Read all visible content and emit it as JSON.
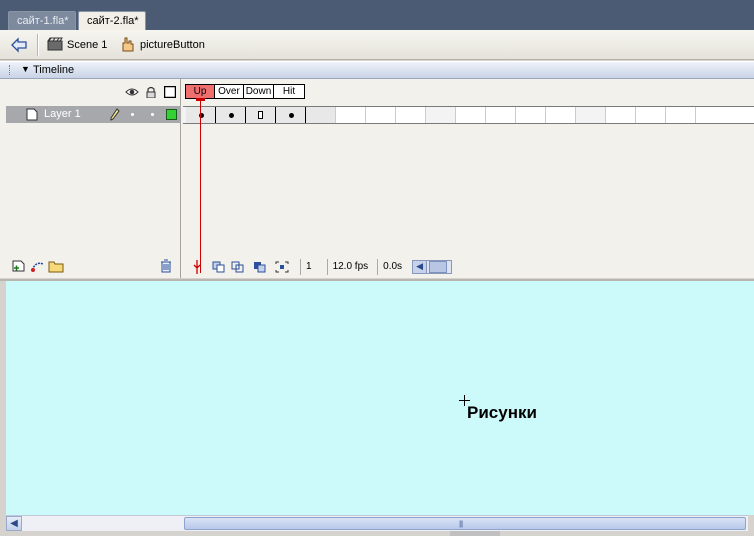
{
  "document_tabs": [
    {
      "label": "сайт-1.fla*",
      "active": false
    },
    {
      "label": "сайт-2.fla*",
      "active": true
    }
  ],
  "edit_bar": {
    "back_icon": "back-arrow-icon",
    "scene_label": "Scene 1",
    "symbol_label": "pictureButton"
  },
  "timeline": {
    "title": "Timeline",
    "header_icons": [
      "eye-icon",
      "lock-icon",
      "outline-icon"
    ],
    "layers": [
      {
        "name": "Layer 1",
        "color": "#33d133"
      }
    ],
    "frame_labels": [
      "Up",
      "Over",
      "Down",
      "Hit"
    ],
    "current_frame_label": "Up",
    "status": {
      "current_frame": "1",
      "frame_rate": "12.0 fps",
      "elapsed_time": "0.0s"
    }
  },
  "stage": {
    "background": "#ccfafa",
    "text": "Рисунки"
  },
  "colors": {
    "timeline_header": "#c8d3e6",
    "playhead": "#cc0000",
    "current_frame_label": "#ef6f6f"
  }
}
